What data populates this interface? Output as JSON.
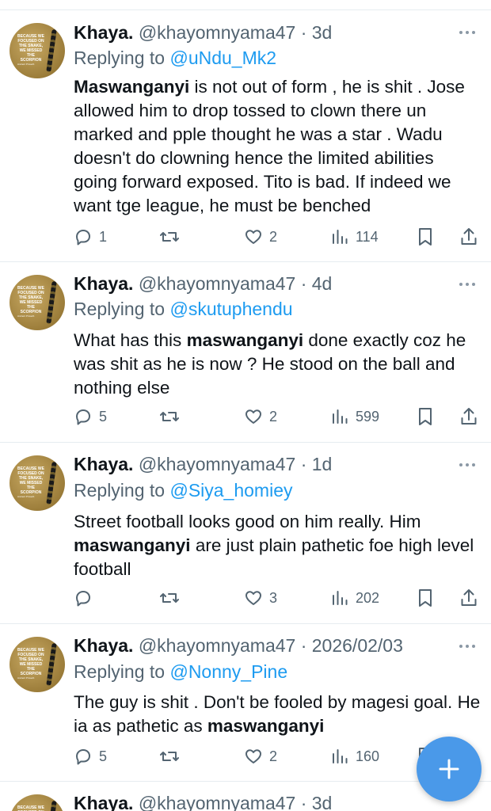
{
  "tweets": [
    {
      "name": "Khaya.",
      "handle": "@khayomnyama47",
      "time": "· 3d",
      "replying_prefix": "Replying to",
      "replying_to": "@uNdu_Mk2",
      "segments": [
        {
          "bold": true,
          "text": "Maswanganyi"
        },
        {
          "bold": false,
          "text": " is not out of form , he is shit . Jose allowed him to drop tossed to clown there un marked and pple thought he was a star . Wadu doesn't do clowning hence the limited abilities going forward exposed.  Tito is bad. If indeed we want tge league, he must be benched"
        }
      ],
      "replies": "1",
      "retweets": "",
      "likes": "2",
      "views": "114"
    },
    {
      "name": "Khaya.",
      "handle": "@khayomnyama47",
      "time": "· 4d",
      "replying_prefix": "Replying to",
      "replying_to": "@skutuphendu",
      "segments": [
        {
          "bold": false,
          "text": "What has this "
        },
        {
          "bold": true,
          "text": "maswanganyi"
        },
        {
          "bold": false,
          "text": " done exactly coz he was shit as he is now ? He stood on the ball and nothing else"
        }
      ],
      "replies": "5",
      "retweets": "",
      "likes": "2",
      "views": "599"
    },
    {
      "name": "Khaya.",
      "handle": "@khayomnyama47",
      "time": "· 1d",
      "replying_prefix": "Replying to",
      "replying_to": "@Siya_homiey",
      "segments": [
        {
          "bold": false,
          "text": "Street football looks good on him really.  Him "
        },
        {
          "bold": true,
          "text": "maswanganyi"
        },
        {
          "bold": false,
          "text": " are just plain pathetic foe high level football"
        }
      ],
      "replies": "",
      "retweets": "",
      "likes": "3",
      "views": "202"
    },
    {
      "name": "Khaya.",
      "handle": "@khayomnyama47",
      "time": "· 2026/02/03",
      "replying_prefix": "Replying to",
      "replying_to": "@Nonny_Pine",
      "segments": [
        {
          "bold": false,
          "text": "The guy is shit . Don't be fooled by magesi goal. He ia as pathetic as "
        },
        {
          "bold": true,
          "text": "maswanganyi"
        }
      ],
      "replies": "5",
      "retweets": "",
      "likes": "2",
      "views": "160"
    },
    {
      "name": "Khaya.",
      "handle": "@khayomnyama47",
      "time": "· 3d"
    }
  ],
  "avatar": {
    "text": "BECAUSE WE FOCUSED ON THE SNAKE, WE MISSED THE SCORPION",
    "small": "Ancient Proverb"
  },
  "icons": {
    "reply": "reply-icon",
    "retweet": "retweet-icon",
    "like": "heart-icon",
    "views": "views-icon",
    "bookmark": "bookmark-icon",
    "share": "share-icon",
    "more": "more-icon",
    "compose": "plus-icon"
  },
  "colors": {
    "accent": "#1d9bf0",
    "fab": "#4a99e9",
    "muted": "#536471"
  }
}
